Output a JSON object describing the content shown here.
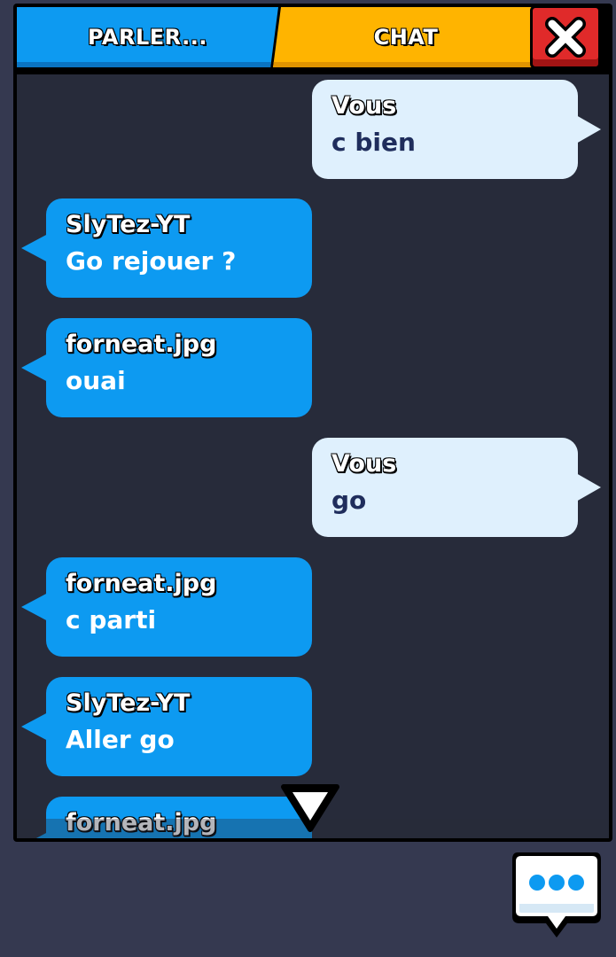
{
  "tabs": {
    "speak_label": "PARLER...",
    "chat_label": "CHAT"
  },
  "messages": [
    {
      "sender": "Vous",
      "text": "c bien",
      "mine": true
    },
    {
      "sender": "SlyTez-YT",
      "text": "Go rejouer ?",
      "mine": false
    },
    {
      "sender": "forneat.jpg",
      "text": "ouai",
      "mine": false
    },
    {
      "sender": "Vous",
      "text": "go",
      "mine": true
    },
    {
      "sender": "forneat.jpg",
      "text": "c parti",
      "mine": false
    },
    {
      "sender": "SlyTez-YT",
      "text": "Aller go",
      "mine": false
    },
    {
      "sender": "forneat.jpg",
      "text": "",
      "mine": false
    }
  ],
  "icons": {
    "close": "close-icon",
    "scroll_down": "triangle-down-icon",
    "chat_open": "chat-bubble-dots-icon"
  },
  "colors": {
    "background": "#353950",
    "chat_area": "#272b3a",
    "other_bubble": "#0d9af1",
    "my_bubble": "#dff0fd",
    "chat_tab": "#ffb400",
    "close_button": "#e02a2a"
  }
}
